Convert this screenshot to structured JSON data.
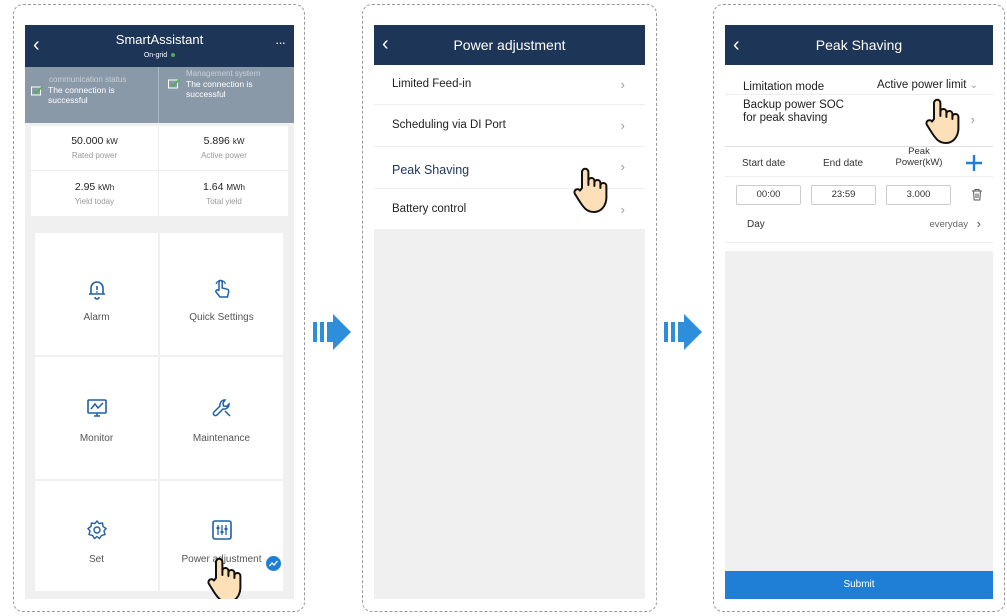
{
  "screen1": {
    "title": "SmartAssistant",
    "grid_status": "On-grid",
    "back_icon": "back-chevron-icon",
    "more_icon": "more-dots-icon",
    "comm_label": "communication status",
    "comm_value": "The connection is successful",
    "mgmt_label": "Management system",
    "mgmt_value": "The connection is successful",
    "stats": [
      {
        "value": "50.000",
        "unit": "kW",
        "label": "Rated power"
      },
      {
        "value": "5.896",
        "unit": "kW",
        "label": "Active power"
      },
      {
        "value": "2.95",
        "unit": "kWh",
        "label": "Yield today"
      },
      {
        "value": "1.64",
        "unit": "MWh",
        "label": "Total yield"
      }
    ],
    "menu": [
      {
        "label": "Alarm",
        "icon": "bell-icon"
      },
      {
        "label": "Quick Settings",
        "icon": "hand-pointer-icon"
      },
      {
        "label": "Monitor",
        "icon": "monitor-icon"
      },
      {
        "label": "Maintenance",
        "icon": "wrench-icon"
      },
      {
        "label": "Set",
        "icon": "gear-icon"
      },
      {
        "label": "Power adjustment",
        "icon": "sliders-icon"
      }
    ]
  },
  "screen2": {
    "title": "Power adjustment",
    "items": [
      "Limited Feed-in",
      "Scheduling via DI Port",
      "Peak Shaving",
      "Battery control"
    ]
  },
  "screen3": {
    "title": "Peak Shaving",
    "limitation_label": "Limitation mode",
    "limitation_value": "Active power limit",
    "backup_label": "Backup power SOC for peak shaving",
    "col_start": "Start date",
    "col_end": "End date",
    "col_peak": "Peak Power(kW)",
    "row_start": "00:00",
    "row_end": "23:59",
    "row_peak": "3.000",
    "day_label": "Day",
    "day_value": "everyday",
    "submit": "Submit"
  },
  "colors": {
    "header": "#1d3557",
    "accent": "#1f7fd6",
    "arrow": "#2d8fdc",
    "green": "#4caf50"
  }
}
